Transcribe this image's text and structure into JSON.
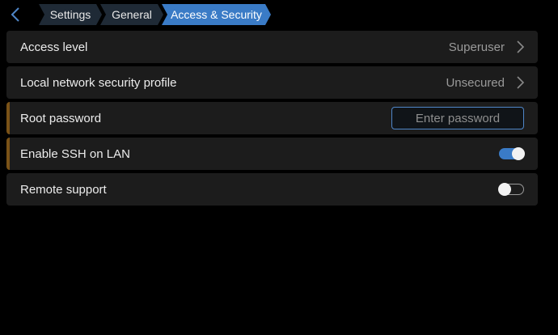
{
  "breadcrumb": {
    "items": [
      {
        "label": "Settings"
      },
      {
        "label": "General"
      },
      {
        "label": "Access & Security"
      }
    ],
    "back_icon": "chevron-left-icon"
  },
  "rows": [
    {
      "label": "Access level",
      "value": "Superuser",
      "type": "navigation"
    },
    {
      "label": "Local network security profile",
      "value": "Unsecured",
      "type": "navigation"
    },
    {
      "label": "Root password",
      "placeholder": "Enter password",
      "value": "",
      "type": "input"
    },
    {
      "label": "Enable SSH on LAN",
      "type": "toggle",
      "state": "on"
    },
    {
      "label": "Remote support",
      "type": "toggle",
      "state": "off"
    }
  ],
  "colors": {
    "accent_blue": "#3a7bc6",
    "row_bg": "#1c1c1c",
    "warning_bar": "#7a5217",
    "background": "#000000"
  }
}
